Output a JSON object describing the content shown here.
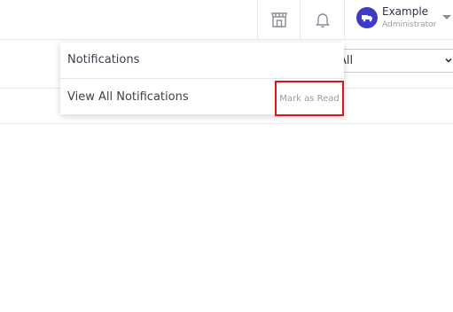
{
  "header": {
    "store_icon": "store-icon",
    "bell_icon": "bell-icon",
    "user": {
      "name": "Example",
      "role": "Administrator",
      "avatar_icon": "truck-icon",
      "avatar_color": "#3f3bc4"
    }
  },
  "filter": {
    "selected": "All"
  },
  "notifications": {
    "title": "Notifications",
    "view_all": "View All Notifications",
    "mark_as_read": "Mark as Read"
  },
  "colors": {
    "highlight": "#e3141b",
    "border": "#e6e8ec"
  }
}
